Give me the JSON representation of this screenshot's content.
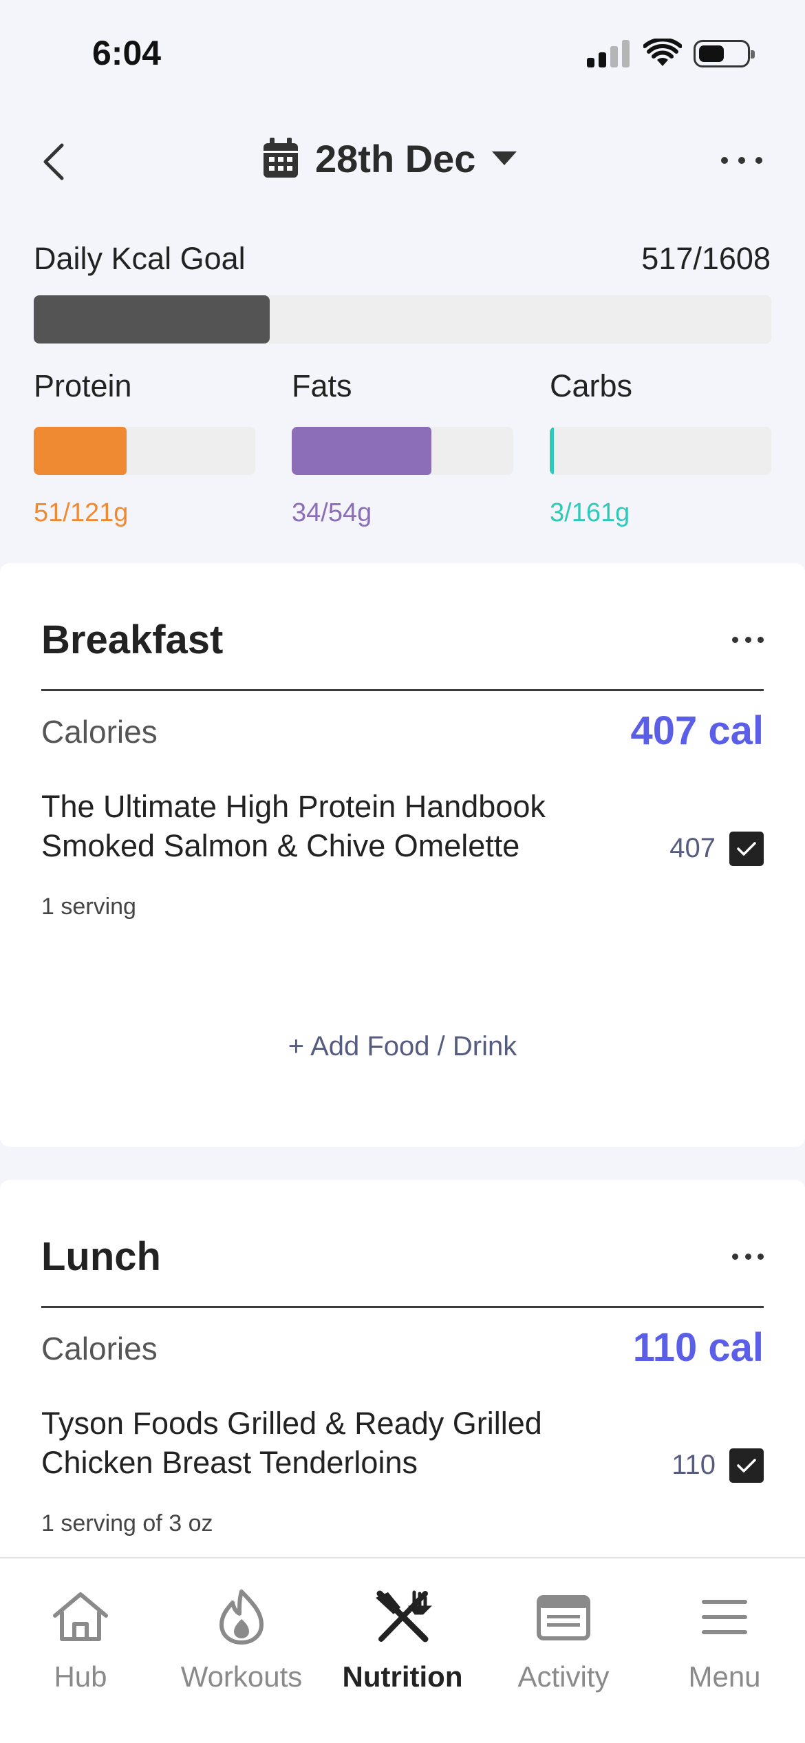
{
  "status": {
    "time": "6:04"
  },
  "header": {
    "date": "28th Dec"
  },
  "goals": {
    "kcal_label": "Daily Kcal Goal",
    "kcal_value": "517/1608",
    "kcal_progress": 0.32,
    "macros": [
      {
        "label": "Protein",
        "value": "51/121g",
        "progress": 0.42,
        "color": "#f08a32"
      },
      {
        "label": "Fats",
        "value": "34/54g",
        "progress": 0.63,
        "color": "#8c6db7"
      },
      {
        "label": "Carbs",
        "value": "3/161g",
        "progress": 0.02,
        "color": "#2ec9b9"
      }
    ]
  },
  "meals": [
    {
      "title": "Breakfast",
      "calories_label": "Calories",
      "calories_total": "407 cal",
      "food_name": "The Ultimate High Protein Handbook Smoked Salmon & Chive Omelette",
      "food_cal": "407",
      "food_serving": "1 serving",
      "add_label": "+ Add Food / Drink"
    },
    {
      "title": "Lunch",
      "calories_label": "Calories",
      "calories_total": "110 cal",
      "food_name": "Tyson Foods Grilled & Ready Grilled Chicken Breast Tenderloins",
      "food_cal": "110",
      "food_serving": "1 serving of 3 oz"
    }
  ],
  "nav": [
    {
      "label": "Hub",
      "icon": "home-icon"
    },
    {
      "label": "Workouts",
      "icon": "flame-icon"
    },
    {
      "label": "Nutrition",
      "icon": "fork-knife-icon",
      "active": true
    },
    {
      "label": "Activity",
      "icon": "newspaper-icon"
    },
    {
      "label": "Menu",
      "icon": "hamburger-icon"
    }
  ],
  "colors": {
    "accent": "#5b5ee6",
    "muted_text": "#555c80"
  }
}
